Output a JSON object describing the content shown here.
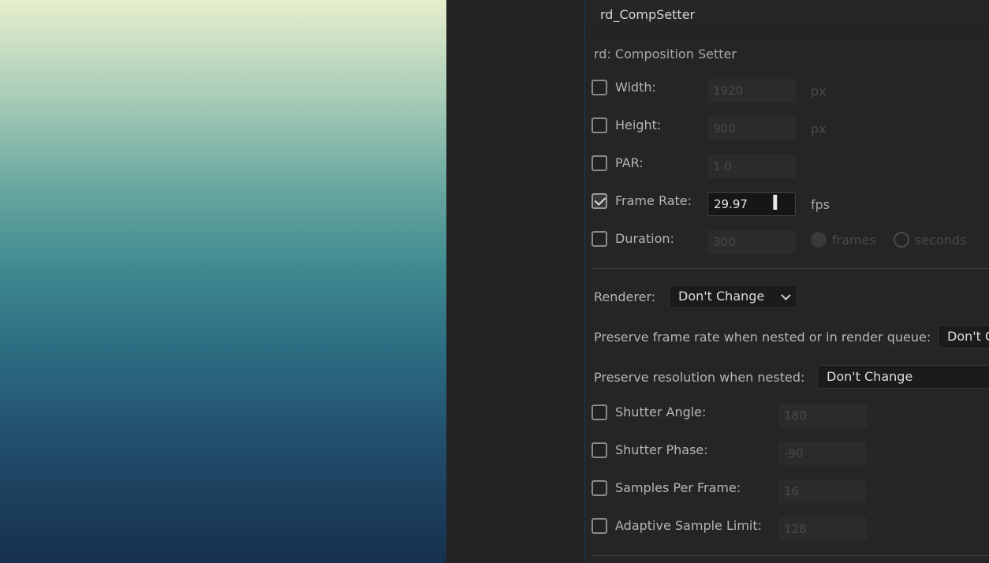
{
  "panel": {
    "title": "rd_CompSetter",
    "heading": "rd: Composition Setter"
  },
  "rows": {
    "width": {
      "label": "Width:",
      "value": "1920",
      "unit": "px",
      "checked": false
    },
    "height": {
      "label": "Height:",
      "value": "900",
      "unit": "px",
      "checked": false
    },
    "par": {
      "label": "PAR:",
      "value": "1.0",
      "checked": false
    },
    "frame_rate": {
      "label": "Frame Rate:",
      "value": "29.97",
      "unit": "fps",
      "checked": true
    },
    "duration": {
      "label": "Duration:",
      "value": "300",
      "option_frames": "frames",
      "option_seconds": "seconds",
      "checked": false
    }
  },
  "renderer": {
    "label": "Renderer:",
    "value": "Don't Change"
  },
  "preserve_frame_rate": {
    "label": "Preserve frame rate when nested or in render queue:",
    "value": "Don't C"
  },
  "preserve_resolution": {
    "label": "Preserve resolution when nested:",
    "value": "Don't Change"
  },
  "motion_blur": {
    "shutter_angle": {
      "label": "Shutter Angle:",
      "value": "180",
      "checked": false
    },
    "shutter_phase": {
      "label": "Shutter Phase:",
      "value": "-90",
      "checked": false
    },
    "samples_per_frame": {
      "label": "Samples Per Frame:",
      "value": "16",
      "checked": false
    },
    "adaptive_sample_limit": {
      "label": "Adaptive Sample Limit:",
      "value": "128",
      "checked": false
    }
  },
  "colors": {
    "panel_bg": "#252525",
    "preview_top": "#e6efcd",
    "preview_bottom": "#16304f"
  },
  "icons": {
    "cursor": "text-cursor-icon",
    "chevron": "chevron-down-icon"
  }
}
